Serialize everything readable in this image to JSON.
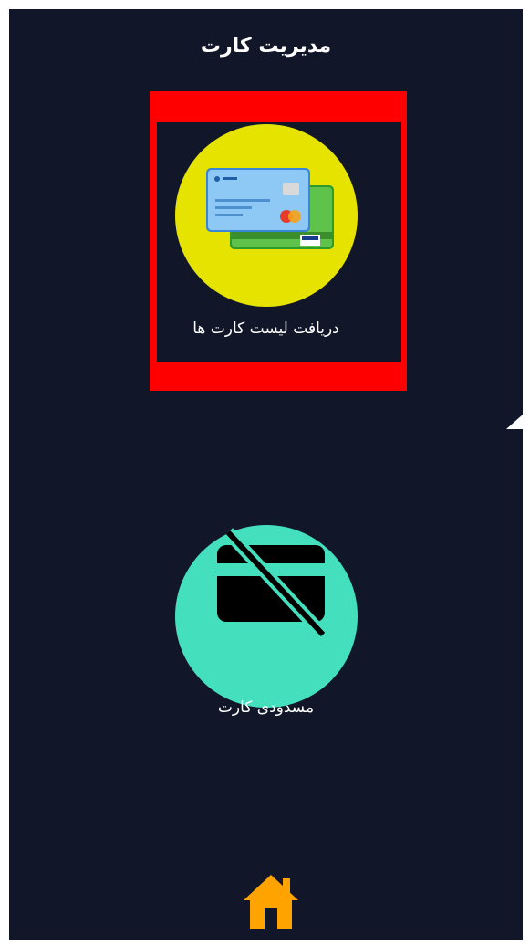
{
  "header": {
    "title": "مدیریت کارت"
  },
  "tiles": [
    {
      "label": "دریافت لیست کارت ها",
      "icon": "credit-cards-icon",
      "circle_color": "#e6e300"
    },
    {
      "label": "مسدودی کارت",
      "icon": "card-blocked-icon",
      "circle_color": "#44dfbd"
    }
  ],
  "nav": {
    "home_icon": "home-icon",
    "home_color": "#ffa300"
  },
  "colors": {
    "background": "#121629",
    "highlight": "#ff0000"
  }
}
